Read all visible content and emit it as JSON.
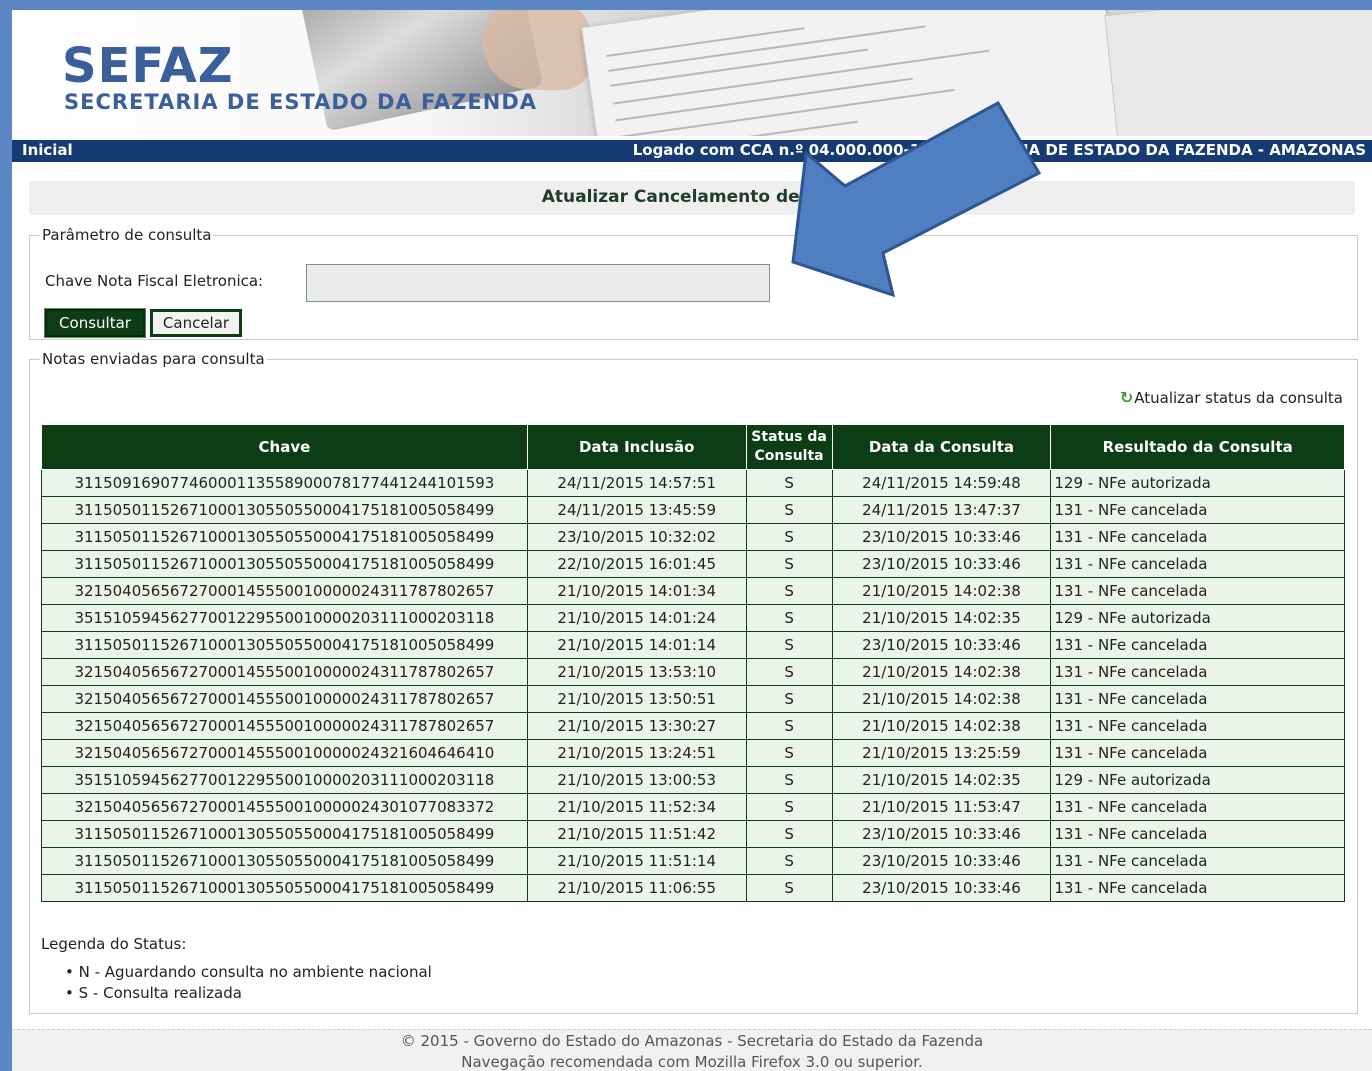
{
  "header": {
    "logo_title": "SEFAZ",
    "logo_subtitle": "SECRETARIA DE ESTADO DA FAZENDA"
  },
  "nav": {
    "home": "Inicial",
    "login_info": "Logado com CCA n.º 04.000.000-1 - SECRETARIA DE ESTADO DA FAZENDA - AMAZONAS"
  },
  "page": {
    "title": "Atualizar Cancelamento de NFe"
  },
  "params": {
    "legend": "Parâmetro de consulta",
    "chave_label": "Chave Nota Fiscal Eletronica:",
    "chave_value": "",
    "consultar_label": "Consultar",
    "cancelar_label": "Cancelar"
  },
  "notes": {
    "legend": "Notas enviadas para consulta",
    "refresh_label": "Atualizar status da consulta",
    "columns": [
      "Chave",
      "Data Inclusão",
      "Status da Consulta",
      "Data da Consulta",
      "Resultado da Consulta"
    ],
    "rows": [
      [
        "31150916907746000113558900078177441244101593",
        "24/11/2015 14:57:51",
        "S",
        "24/11/2015 14:59:48",
        "129 - NFe autorizada"
      ],
      [
        "31150501152671000130550550004175181005058499",
        "24/11/2015 13:45:59",
        "S",
        "24/11/2015 13:47:37",
        "131 - NFe cancelada"
      ],
      [
        "31150501152671000130550550004175181005058499",
        "23/10/2015 10:32:02",
        "S",
        "23/10/2015 10:33:46",
        "131 - NFe cancelada"
      ],
      [
        "31150501152671000130550550004175181005058499",
        "22/10/2015 16:01:45",
        "S",
        "23/10/2015 10:33:46",
        "131 - NFe cancelada"
      ],
      [
        "32150405656727000145550010000024311787802657",
        "21/10/2015 14:01:34",
        "S",
        "21/10/2015 14:02:38",
        "131 - NFe cancelada"
      ],
      [
        "35151059456277001229550010000203111000203118",
        "21/10/2015 14:01:24",
        "S",
        "21/10/2015 14:02:35",
        "129 - NFe autorizada"
      ],
      [
        "31150501152671000130550550004175181005058499",
        "21/10/2015 14:01:14",
        "S",
        "23/10/2015 10:33:46",
        "131 - NFe cancelada"
      ],
      [
        "32150405656727000145550010000024311787802657",
        "21/10/2015 13:53:10",
        "S",
        "21/10/2015 14:02:38",
        "131 - NFe cancelada"
      ],
      [
        "32150405656727000145550010000024311787802657",
        "21/10/2015 13:50:51",
        "S",
        "21/10/2015 14:02:38",
        "131 - NFe cancelada"
      ],
      [
        "32150405656727000145550010000024311787802657",
        "21/10/2015 13:30:27",
        "S",
        "21/10/2015 14:02:38",
        "131 - NFe cancelada"
      ],
      [
        "32150405656727000145550010000024321604646410",
        "21/10/2015 13:24:51",
        "S",
        "21/10/2015 13:25:59",
        "131 - NFe cancelada"
      ],
      [
        "35151059456277001229550010000203111000203118",
        "21/10/2015 13:00:53",
        "S",
        "21/10/2015 14:02:35",
        "129 - NFe autorizada"
      ],
      [
        "32150405656727000145550010000024301077083372",
        "21/10/2015 11:52:34",
        "S",
        "21/10/2015 11:53:47",
        "131 - NFe cancelada"
      ],
      [
        "31150501152671000130550550004175181005058499",
        "21/10/2015 11:51:42",
        "S",
        "23/10/2015 10:33:46",
        "131 - NFe cancelada"
      ],
      [
        "31150501152671000130550550004175181005058499",
        "21/10/2015 11:51:14",
        "S",
        "23/10/2015 10:33:46",
        "131 - NFe cancelada"
      ],
      [
        "31150501152671000130550550004175181005058499",
        "21/10/2015 11:06:55",
        "S",
        "23/10/2015 10:33:46",
        "131 - NFe cancelada"
      ]
    ],
    "legend_title": "Legenda do Status:",
    "legend_items": [
      "N - Aguardando consulta no ambiente nacional",
      "S - Consulta realizada"
    ]
  },
  "footer": {
    "line1": "© 2015 - Governo do Estado do Amazonas - Secretaria do Estado da Fazenda",
    "line2": "Navegação recomendada com Mozilla Firefox 3.0 ou superior."
  },
  "colors": {
    "header_green": "#0d3d14",
    "row_bg": "#e8f5e8",
    "nav_blue": "#163a72",
    "arrow_blue": "#4f7fc0"
  },
  "icons": {
    "refresh": "refresh-icon",
    "arrow": "pointer-arrow-icon"
  }
}
